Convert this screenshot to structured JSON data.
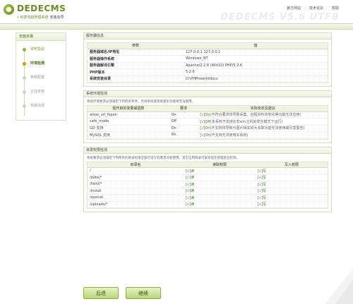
{
  "header": {
    "logo_text": "DEDECMS",
    "logo_sub": "• 织梦内容管理系统",
    "logo_sub_alt": "安装向导",
    "links": [
      "官方网站",
      "技术论坛",
      "帮助"
    ],
    "watermark": "DEDECMS V5.6 UTF8"
  },
  "sidebar": {
    "title": "安装步骤",
    "steps": [
      {
        "label": "许可协议",
        "state": "done"
      },
      {
        "label": "环境检测",
        "state": "active"
      },
      {
        "label": "参数配置",
        "state": "todo"
      },
      {
        "label": "正在安装",
        "state": "todo"
      },
      {
        "label": "安装完成",
        "state": "todo"
      }
    ]
  },
  "server": {
    "title": "服务器信息",
    "col_param": "参数",
    "col_value": "值",
    "rows": [
      {
        "k": "服务器域名/IP地址",
        "v": "127.0.0.1 127.0.0.1"
      },
      {
        "k": "服务器操作系统",
        "v": "Windows_NT"
      },
      {
        "k": "服务器解译引擎",
        "v": "Apache/2.2.8 (Win32) PHP/5.2.6"
      },
      {
        "k": "PHP版本",
        "v": "5.2.6"
      },
      {
        "k": "系统安装目录",
        "v": "D:\\PHPnow\\htdocs"
      }
    ]
  },
  "env": {
    "title": "系统环境检测",
    "note": "系统环境要求必须满足下列所有条件，否则系统或系统部份功能将无法使用。",
    "col_item": "需开启的变量或函数",
    "col_req": "要求",
    "col_state": "实际状态及建议",
    "rows": [
      {
        "name": "allow_url_fopen",
        "req": "On",
        "ok": "[√]On",
        "hint": "(不符合要求将导致采集、远程资料本地化等功能无法应用)"
      },
      {
        "name": "safe_mode",
        "req": "Off",
        "ok": "[√]Off",
        "hint": "(本系统不支持在非win主机的安全模式下运行)"
      },
      {
        "name": "GD 支持",
        "req": "On",
        "ok": "[√]On",
        "hint": "(不支持将导致与图片相关的大多数功能无法使用或引发警告)"
      },
      {
        "name": "MySQL 支持",
        "req": "On",
        "ok": "[√]On",
        "hint": "(不支持无法使用本系统)"
      }
    ]
  },
  "dirs": {
    "title": "目录权限检测",
    "note": "系统要求必须满足下列所有的目录权限全部可读写的需求才能使用，其它应用目录可安装后在管理后台检测。",
    "col_dir": "目录名",
    "col_read": "读取权限",
    "col_write": "写入权限",
    "rows": [
      {
        "dir": "/",
        "r": "[√]读",
        "w": "[√]写"
      },
      {
        "dir": "/data/*",
        "r": "[√]读",
        "w": "[√]写"
      },
      {
        "dir": "/html/*",
        "r": "[√]读",
        "w": "[√]写"
      },
      {
        "dir": "/install",
        "r": "[√]读",
        "w": "[√]写"
      },
      {
        "dir": "/special",
        "r": "[√]读",
        "w": "[√]写"
      },
      {
        "dir": "/uploads/*",
        "r": "[√]读",
        "w": "[√]写"
      }
    ]
  },
  "buttons": {
    "back": "后退",
    "next": "继续"
  }
}
